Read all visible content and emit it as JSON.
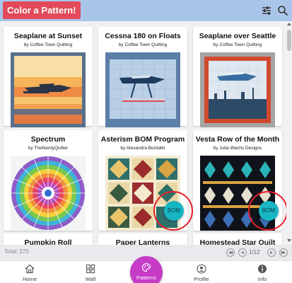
{
  "app": {
    "title": "Color a Pattern!"
  },
  "patterns": [
    {
      "title": "Seaplane at Sunset",
      "author": "by Coffee Town Quilting"
    },
    {
      "title": "Cessna 180 on Floats",
      "author": "by Coffee Town Quilting"
    },
    {
      "title": "Seaplane over Seattle",
      "author": "by Coffee Town Quilting"
    },
    {
      "title": "Spectrum",
      "author": "by TheNerdyQuilter"
    },
    {
      "title": "Asterism BOM Program",
      "author": "by Alexandra Bordallo",
      "badge": "BOM"
    },
    {
      "title": "Vesta Row of the Month",
      "author": "by Julia Wachs Designs",
      "badge": "BOM"
    },
    {
      "title": "Pumpkin Roll",
      "author": ""
    },
    {
      "title": "Paper Lanterns",
      "author": ""
    },
    {
      "title": "Homestead Star Quilt",
      "author": ""
    }
  ],
  "status": {
    "total": "Total: 270",
    "page": "1/12"
  },
  "nav": {
    "items": [
      {
        "label": "Home",
        "icon": "home-icon"
      },
      {
        "label": "Wall",
        "icon": "wall-grid-icon"
      },
      {
        "label": "Patterns",
        "icon": "palette-icon",
        "active": true
      },
      {
        "label": "Profile",
        "icon": "profile-icon"
      },
      {
        "label": "Info",
        "icon": "info-icon"
      }
    ]
  },
  "colors": {
    "topbar": "#a9c6ea",
    "title_bg": "#e24a5a",
    "badge": "#17b5c4",
    "highlight": "#e8202a",
    "active_nav": "#c63cc6"
  }
}
